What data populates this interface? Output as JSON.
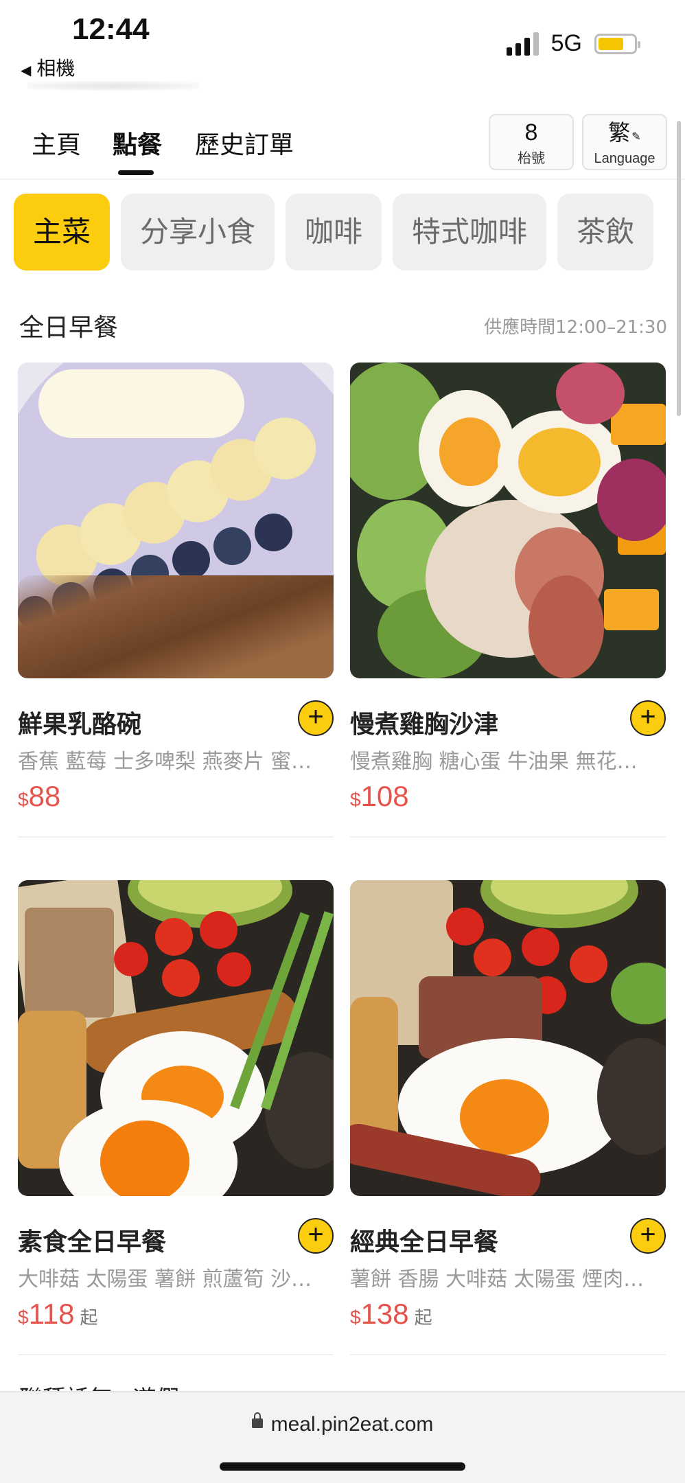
{
  "status_bar": {
    "time": "12:44",
    "back_label": "相機",
    "network": "5G"
  },
  "nav": {
    "tabs": [
      "主頁",
      "點餐",
      "歷史訂單"
    ],
    "active_tab": "點餐",
    "table": {
      "number": "8",
      "label": "枱號"
    },
    "language": {
      "glyph": "繁",
      "label": "Language"
    }
  },
  "categories": [
    "主菜",
    "分享小食",
    "咖啡",
    "特式咖啡",
    "茶飲"
  ],
  "active_category": "主菜",
  "section": {
    "title": "全日早餐",
    "hours": "供應時間12:00–21:30"
  },
  "items": [
    {
      "name": "鮮果乳酪碗",
      "desc": "香蕉 藍莓 士多啤梨 燕麥片 蜜…",
      "currency": "$",
      "price": "88",
      "suffix": ""
    },
    {
      "name": "慢煮雞胸沙津",
      "desc": "慢煮雞胸 糖心蛋 牛油果 無花…",
      "currency": "$",
      "price": "108",
      "suffix": ""
    },
    {
      "name": "素食全日早餐",
      "desc": "大啡菇 太陽蛋 薯餅 煎蘆筍 沙…",
      "currency": "$",
      "price": "118",
      "suffix": "起"
    },
    {
      "name": "經典全日早餐",
      "desc": "薯餅 香腸 大啡菇 太陽蛋 煙肉…",
      "currency": "$",
      "price": "138",
      "suffix": "起"
    }
  ],
  "next_section_partial": "聯種話無○遊假",
  "browser": {
    "url": "meal.pin2eat.com"
  },
  "colors": {
    "accent": "#fccd0e",
    "price": "#e5534b"
  }
}
